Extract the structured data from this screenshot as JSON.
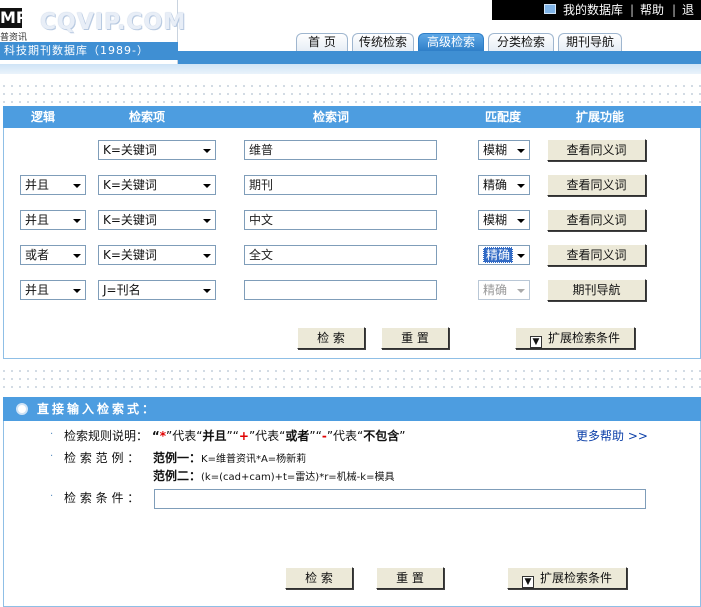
{
  "header": {
    "logo_mark": "MP",
    "logo_text": "CQVIP.COM",
    "logo_sub": "普资讯",
    "banner": "科技期刊数据库（1989-）",
    "my_database": "我的数据库",
    "help": "帮助",
    "logout": "退出",
    "separator": "|"
  },
  "tabs": [
    {
      "label": "首  页"
    },
    {
      "label": "传统检索"
    },
    {
      "label": "高级检索"
    },
    {
      "label": "分类检索"
    },
    {
      "label": "期刊导航"
    }
  ],
  "table": {
    "headers": {
      "logic": "逻辑",
      "field": "检索项",
      "term": "检索词",
      "match": "匹配度",
      "ext": "扩展功能"
    },
    "rows": [
      {
        "logic": "",
        "field": "K=关键词",
        "term": "维普",
        "match": "模糊",
        "action": "查看同义词"
      },
      {
        "logic": "并且",
        "field": "K=关键词",
        "term": "期刊",
        "match": "精确",
        "action": "查看同义词"
      },
      {
        "logic": "并且",
        "field": "K=关键词",
        "term": "中文",
        "match": "模糊",
        "action": "查看同义词"
      },
      {
        "logic": "或者",
        "field": "K=关键词",
        "term": "全文",
        "match": "精确",
        "action": "查看同义词"
      },
      {
        "logic": "并且",
        "field": "J=刊名",
        "term": "",
        "match": "精确",
        "action": "期刊导航"
      }
    ],
    "search_button": "检 索",
    "reset_button": "重 置",
    "expand_button": "扩展检索条件"
  },
  "direct": {
    "title": "直接输入检索式：",
    "rules_label": "检索规则说明：",
    "rule_q1": "“",
    "rule_star": "*",
    "rule_q2": "”代表“",
    "rule_and": "并且",
    "rule_q3": "”“",
    "rule_plus": "+",
    "rule_q4": "”代表“",
    "rule_or": "或者",
    "rule_q5": "”“",
    "rule_minus": "-",
    "rule_q6": "”代表“",
    "rule_not": "不包含",
    "rule_q7": "”",
    "more_help": "更多帮助 >>",
    "example_label": "检 索 范 例 ：",
    "example1_label": "范例一：",
    "example1": "K=维普资讯*A=杨新莉",
    "example2_label": "范例二：",
    "example2": "(k=(cad+cam)+t=雷达)*r=机械-k=模具",
    "condition_label": "检 索 条 件 ：",
    "condition_value": "",
    "search_button": "检 索",
    "reset_button": "重 置",
    "expand_button": "扩展检索条件"
  }
}
